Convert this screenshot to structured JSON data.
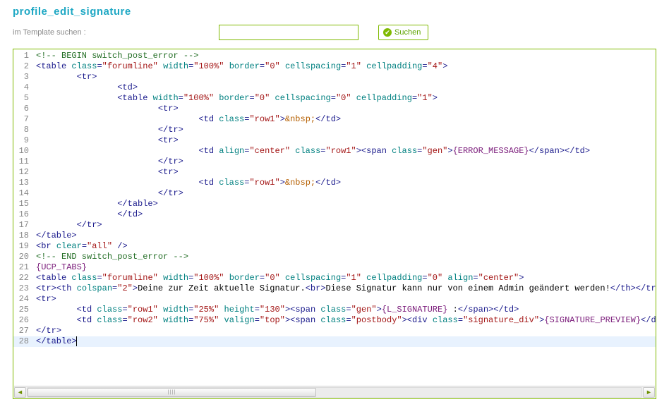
{
  "page_title": "profile_edit_signature",
  "search": {
    "label": "im Template suchen :",
    "value": "",
    "button": "Suchen"
  },
  "code": {
    "lines": [
      {
        "n": 1,
        "class": "",
        "tokens": [
          [
            "comment",
            "<!-- BEGIN switch_post_error -->"
          ]
        ]
      },
      {
        "n": 2,
        "class": "",
        "tokens": [
          [
            "punc",
            "<"
          ],
          [
            "tag",
            "table "
          ],
          [
            "attr",
            "class"
          ],
          [
            "punc",
            "="
          ],
          [
            "str",
            "\"forumline\""
          ],
          [
            "text",
            " "
          ],
          [
            "attr",
            "width"
          ],
          [
            "punc",
            "="
          ],
          [
            "str",
            "\"100%\""
          ],
          [
            "text",
            " "
          ],
          [
            "attr",
            "border"
          ],
          [
            "punc",
            "="
          ],
          [
            "str",
            "\"0\""
          ],
          [
            "text",
            " "
          ],
          [
            "attr",
            "cellspacing"
          ],
          [
            "punc",
            "="
          ],
          [
            "str",
            "\"1\""
          ],
          [
            "text",
            " "
          ],
          [
            "attr",
            "cellpadding"
          ],
          [
            "punc",
            "="
          ],
          [
            "str",
            "\"4\""
          ],
          [
            "punc",
            ">"
          ]
        ]
      },
      {
        "n": 3,
        "class": "",
        "tokens": [
          [
            "text",
            "        "
          ],
          [
            "punc",
            "<"
          ],
          [
            "tag",
            "tr"
          ],
          [
            "punc",
            ">"
          ]
        ]
      },
      {
        "n": 4,
        "class": "",
        "tokens": [
          [
            "text",
            "                "
          ],
          [
            "punc",
            "<"
          ],
          [
            "tag",
            "td"
          ],
          [
            "punc",
            ">"
          ]
        ]
      },
      {
        "n": 5,
        "class": "",
        "tokens": [
          [
            "text",
            "                "
          ],
          [
            "punc",
            "<"
          ],
          [
            "tag",
            "table "
          ],
          [
            "attr",
            "width"
          ],
          [
            "punc",
            "="
          ],
          [
            "str",
            "\"100%\""
          ],
          [
            "text",
            " "
          ],
          [
            "attr",
            "border"
          ],
          [
            "punc",
            "="
          ],
          [
            "str",
            "\"0\""
          ],
          [
            "text",
            " "
          ],
          [
            "attr",
            "cellspacing"
          ],
          [
            "punc",
            "="
          ],
          [
            "str",
            "\"0\""
          ],
          [
            "text",
            " "
          ],
          [
            "attr",
            "cellpadding"
          ],
          [
            "punc",
            "="
          ],
          [
            "str",
            "\"1\""
          ],
          [
            "punc",
            ">"
          ]
        ]
      },
      {
        "n": 6,
        "class": "",
        "tokens": [
          [
            "text",
            "                        "
          ],
          [
            "punc",
            "<"
          ],
          [
            "tag",
            "tr"
          ],
          [
            "punc",
            ">"
          ]
        ]
      },
      {
        "n": 7,
        "class": "",
        "tokens": [
          [
            "text",
            "                                "
          ],
          [
            "punc",
            "<"
          ],
          [
            "tag",
            "td "
          ],
          [
            "attr",
            "class"
          ],
          [
            "punc",
            "="
          ],
          [
            "str",
            "\"row1\""
          ],
          [
            "punc",
            ">"
          ],
          [
            "ent",
            "&nbsp;"
          ],
          [
            "punc",
            "</"
          ],
          [
            "tag",
            "td"
          ],
          [
            "punc",
            ">"
          ]
        ]
      },
      {
        "n": 8,
        "class": "",
        "tokens": [
          [
            "text",
            "                        "
          ],
          [
            "punc",
            "</"
          ],
          [
            "tag",
            "tr"
          ],
          [
            "punc",
            ">"
          ]
        ]
      },
      {
        "n": 9,
        "class": "",
        "tokens": [
          [
            "text",
            "                        "
          ],
          [
            "punc",
            "<"
          ],
          [
            "tag",
            "tr"
          ],
          [
            "punc",
            ">"
          ]
        ]
      },
      {
        "n": 10,
        "class": "",
        "tokens": [
          [
            "text",
            "                                "
          ],
          [
            "punc",
            "<"
          ],
          [
            "tag",
            "td "
          ],
          [
            "attr",
            "align"
          ],
          [
            "punc",
            "="
          ],
          [
            "str",
            "\"center\""
          ],
          [
            "text",
            " "
          ],
          [
            "attr",
            "class"
          ],
          [
            "punc",
            "="
          ],
          [
            "str",
            "\"row1\""
          ],
          [
            "punc",
            ">"
          ],
          [
            "punc",
            "<"
          ],
          [
            "tag",
            "span "
          ],
          [
            "attr",
            "class"
          ],
          [
            "punc",
            "="
          ],
          [
            "str",
            "\"gen\""
          ],
          [
            "punc",
            ">"
          ],
          [
            "brace",
            "{ERROR_MESSAGE}"
          ],
          [
            "punc",
            "</"
          ],
          [
            "tag",
            "span"
          ],
          [
            "punc",
            ">"
          ],
          [
            "punc",
            "</"
          ],
          [
            "tag",
            "td"
          ],
          [
            "punc",
            ">"
          ]
        ]
      },
      {
        "n": 11,
        "class": "",
        "tokens": [
          [
            "text",
            "                        "
          ],
          [
            "punc",
            "</"
          ],
          [
            "tag",
            "tr"
          ],
          [
            "punc",
            ">"
          ]
        ]
      },
      {
        "n": 12,
        "class": "",
        "tokens": [
          [
            "text",
            "                        "
          ],
          [
            "punc",
            "<"
          ],
          [
            "tag",
            "tr"
          ],
          [
            "punc",
            ">"
          ]
        ]
      },
      {
        "n": 13,
        "class": "",
        "tokens": [
          [
            "text",
            "                                "
          ],
          [
            "punc",
            "<"
          ],
          [
            "tag",
            "td "
          ],
          [
            "attr",
            "class"
          ],
          [
            "punc",
            "="
          ],
          [
            "str",
            "\"row1\""
          ],
          [
            "punc",
            ">"
          ],
          [
            "ent",
            "&nbsp;"
          ],
          [
            "punc",
            "</"
          ],
          [
            "tag",
            "td"
          ],
          [
            "punc",
            ">"
          ]
        ]
      },
      {
        "n": 14,
        "class": "",
        "tokens": [
          [
            "text",
            "                        "
          ],
          [
            "punc",
            "</"
          ],
          [
            "tag",
            "tr"
          ],
          [
            "punc",
            ">"
          ]
        ]
      },
      {
        "n": 15,
        "class": "",
        "tokens": [
          [
            "text",
            "                "
          ],
          [
            "punc",
            "</"
          ],
          [
            "tag",
            "table"
          ],
          [
            "punc",
            ">"
          ]
        ]
      },
      {
        "n": 16,
        "class": "",
        "tokens": [
          [
            "text",
            "                "
          ],
          [
            "punc",
            "</"
          ],
          [
            "tag",
            "td"
          ],
          [
            "punc",
            ">"
          ]
        ]
      },
      {
        "n": 17,
        "class": "",
        "tokens": [
          [
            "text",
            "        "
          ],
          [
            "punc",
            "</"
          ],
          [
            "tag",
            "tr"
          ],
          [
            "punc",
            ">"
          ]
        ]
      },
      {
        "n": 18,
        "class": "",
        "tokens": [
          [
            "punc",
            "</"
          ],
          [
            "tag",
            "table"
          ],
          [
            "punc",
            ">"
          ]
        ]
      },
      {
        "n": 19,
        "class": "",
        "tokens": [
          [
            "punc",
            "<"
          ],
          [
            "tag",
            "br "
          ],
          [
            "attr",
            "clear"
          ],
          [
            "punc",
            "="
          ],
          [
            "str",
            "\"all\""
          ],
          [
            "text",
            " "
          ],
          [
            "punc",
            "/>"
          ]
        ]
      },
      {
        "n": 20,
        "class": "",
        "tokens": [
          [
            "comment",
            "<!-- END switch_post_error -->"
          ]
        ]
      },
      {
        "n": 21,
        "class": "",
        "tokens": [
          [
            "brace",
            "{UCP_TABS}"
          ]
        ]
      },
      {
        "n": 22,
        "class": "",
        "tokens": [
          [
            "punc",
            "<"
          ],
          [
            "tag",
            "table "
          ],
          [
            "attr",
            "class"
          ],
          [
            "punc",
            "="
          ],
          [
            "str",
            "\"forumline\""
          ],
          [
            "text",
            " "
          ],
          [
            "attr",
            "width"
          ],
          [
            "punc",
            "="
          ],
          [
            "str",
            "\"100%\""
          ],
          [
            "text",
            " "
          ],
          [
            "attr",
            "border"
          ],
          [
            "punc",
            "="
          ],
          [
            "str",
            "\"0\""
          ],
          [
            "text",
            " "
          ],
          [
            "attr",
            "cellspacing"
          ],
          [
            "punc",
            "="
          ],
          [
            "str",
            "\"1\""
          ],
          [
            "text",
            " "
          ],
          [
            "attr",
            "cellpadding"
          ],
          [
            "punc",
            "="
          ],
          [
            "str",
            "\"0\""
          ],
          [
            "text",
            " "
          ],
          [
            "attr",
            "align"
          ],
          [
            "punc",
            "="
          ],
          [
            "str",
            "\"center\""
          ],
          [
            "punc",
            ">"
          ]
        ]
      },
      {
        "n": 23,
        "class": "",
        "tokens": [
          [
            "punc",
            "<"
          ],
          [
            "tag",
            "tr"
          ],
          [
            "punc",
            ">"
          ],
          [
            "punc",
            "<"
          ],
          [
            "tag",
            "th "
          ],
          [
            "attr",
            "colspan"
          ],
          [
            "punc",
            "="
          ],
          [
            "str",
            "\"2\""
          ],
          [
            "punc",
            ">"
          ],
          [
            "text",
            "Deine zur Zeit aktuelle Signatur."
          ],
          [
            "punc",
            "<"
          ],
          [
            "tag",
            "br"
          ],
          [
            "punc",
            ">"
          ],
          [
            "text",
            "Diese Signatur kann nur von einem Admin geändert werden!"
          ],
          [
            "punc",
            "</"
          ],
          [
            "tag",
            "th"
          ],
          [
            "punc",
            ">"
          ],
          [
            "punc",
            "</"
          ],
          [
            "tag",
            "tr"
          ],
          [
            "punc",
            ">"
          ]
        ]
      },
      {
        "n": 24,
        "class": "",
        "tokens": [
          [
            "punc",
            "<"
          ],
          [
            "tag",
            "tr"
          ],
          [
            "punc",
            ">"
          ]
        ]
      },
      {
        "n": 25,
        "class": "",
        "tokens": [
          [
            "text",
            "        "
          ],
          [
            "punc",
            "<"
          ],
          [
            "tag",
            "td "
          ],
          [
            "attr",
            "class"
          ],
          [
            "punc",
            "="
          ],
          [
            "str",
            "\"row1\""
          ],
          [
            "text",
            " "
          ],
          [
            "attr",
            "width"
          ],
          [
            "punc",
            "="
          ],
          [
            "str",
            "\"25%\""
          ],
          [
            "text",
            " "
          ],
          [
            "attr",
            "height"
          ],
          [
            "punc",
            "="
          ],
          [
            "str",
            "\"130\""
          ],
          [
            "punc",
            ">"
          ],
          [
            "punc",
            "<"
          ],
          [
            "tag",
            "span "
          ],
          [
            "attr",
            "class"
          ],
          [
            "punc",
            "="
          ],
          [
            "str",
            "\"gen\""
          ],
          [
            "punc",
            ">"
          ],
          [
            "brace",
            "{L_SIGNATURE}"
          ],
          [
            "text",
            " :"
          ],
          [
            "punc",
            "</"
          ],
          [
            "tag",
            "span"
          ],
          [
            "punc",
            ">"
          ],
          [
            "punc",
            "</"
          ],
          [
            "tag",
            "td"
          ],
          [
            "punc",
            ">"
          ]
        ]
      },
      {
        "n": 26,
        "class": "",
        "tokens": [
          [
            "text",
            "        "
          ],
          [
            "punc",
            "<"
          ],
          [
            "tag",
            "td "
          ],
          [
            "attr",
            "class"
          ],
          [
            "punc",
            "="
          ],
          [
            "str",
            "\"row2\""
          ],
          [
            "text",
            " "
          ],
          [
            "attr",
            "width"
          ],
          [
            "punc",
            "="
          ],
          [
            "str",
            "\"75%\""
          ],
          [
            "text",
            " "
          ],
          [
            "attr",
            "valign"
          ],
          [
            "punc",
            "="
          ],
          [
            "str",
            "\"top\""
          ],
          [
            "punc",
            ">"
          ],
          [
            "punc",
            "<"
          ],
          [
            "tag",
            "span "
          ],
          [
            "attr",
            "class"
          ],
          [
            "punc",
            "="
          ],
          [
            "str",
            "\"postbody\""
          ],
          [
            "punc",
            ">"
          ],
          [
            "punc",
            "<"
          ],
          [
            "tag",
            "div "
          ],
          [
            "attr",
            "class"
          ],
          [
            "punc",
            "="
          ],
          [
            "str",
            "\"signature_div\""
          ],
          [
            "punc",
            ">"
          ],
          [
            "brace",
            "{SIGNATURE_PREVIEW}"
          ],
          [
            "punc",
            "</"
          ],
          [
            "tag",
            "div"
          ],
          [
            "punc",
            ">"
          ],
          [
            "punc",
            "</"
          ]
        ]
      },
      {
        "n": 27,
        "class": "",
        "tokens": [
          [
            "punc",
            "</"
          ],
          [
            "tag",
            "tr"
          ],
          [
            "punc",
            ">"
          ]
        ]
      },
      {
        "n": 28,
        "class": "cursor",
        "tokens": [
          [
            "punc",
            "</"
          ],
          [
            "tag",
            "table"
          ],
          [
            "punc",
            ">"
          ]
        ]
      }
    ]
  }
}
